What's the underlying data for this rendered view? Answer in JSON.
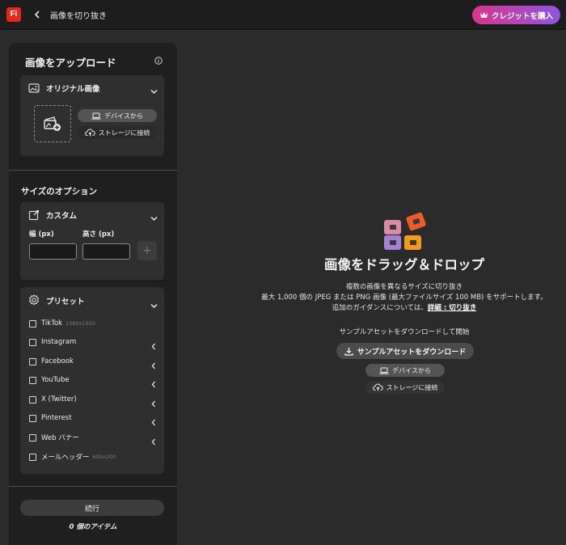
{
  "topbar": {
    "logo": "Fi",
    "title": "画像を切り抜き",
    "credit_button": "クレジットを購入",
    "accent_gradient": [
      "#d9368b",
      "#8f55e0"
    ]
  },
  "upload": {
    "heading": "画像をアップロード",
    "original_card": {
      "label": "オリジナル画像",
      "from_device": "デバイスから",
      "connect_storage": "ストレージに接続"
    }
  },
  "size_options": {
    "heading": "サイズのオプション",
    "custom": {
      "label": "カスタム",
      "width_label": "幅 (px)",
      "height_label": "高さ (px)",
      "width_value": "",
      "height_value": "",
      "add": "+"
    },
    "presets": {
      "label": "プリセット",
      "items": [
        {
          "label": "TikTok",
          "dim": "1080x1920"
        },
        {
          "label": "Instagram",
          "dim": ""
        },
        {
          "label": "Facebook",
          "dim": ""
        },
        {
          "label": "YouTube",
          "dim": ""
        },
        {
          "label": "X (Twitter)",
          "dim": ""
        },
        {
          "label": "Pinterest",
          "dim": ""
        },
        {
          "label": "Web バナー",
          "dim": ""
        },
        {
          "label": "メールヘッダー",
          "dim": "600x200"
        }
      ]
    }
  },
  "footer": {
    "continue": "続行",
    "items_count": "0 個のアイテム"
  },
  "dropzone": {
    "title": "画像をドラッグ＆ドロップ",
    "line1": "複数の画像を異なるサイズに切り抜き",
    "line2": "最大 1,000 個の JPEG または PNG 画像 (最大ファイルサイズ 100 MB) をサポートします。",
    "line3_prefix": "追加のガイダンスについては、",
    "line3_link": "詳細 : 切り抜き",
    "sample_heading": "サンプルアセットをダウンロードして開始",
    "sample_button": "サンプルアセットをダウンロード",
    "from_device": "デバイスから",
    "connect_storage": "ストレージに接続"
  }
}
